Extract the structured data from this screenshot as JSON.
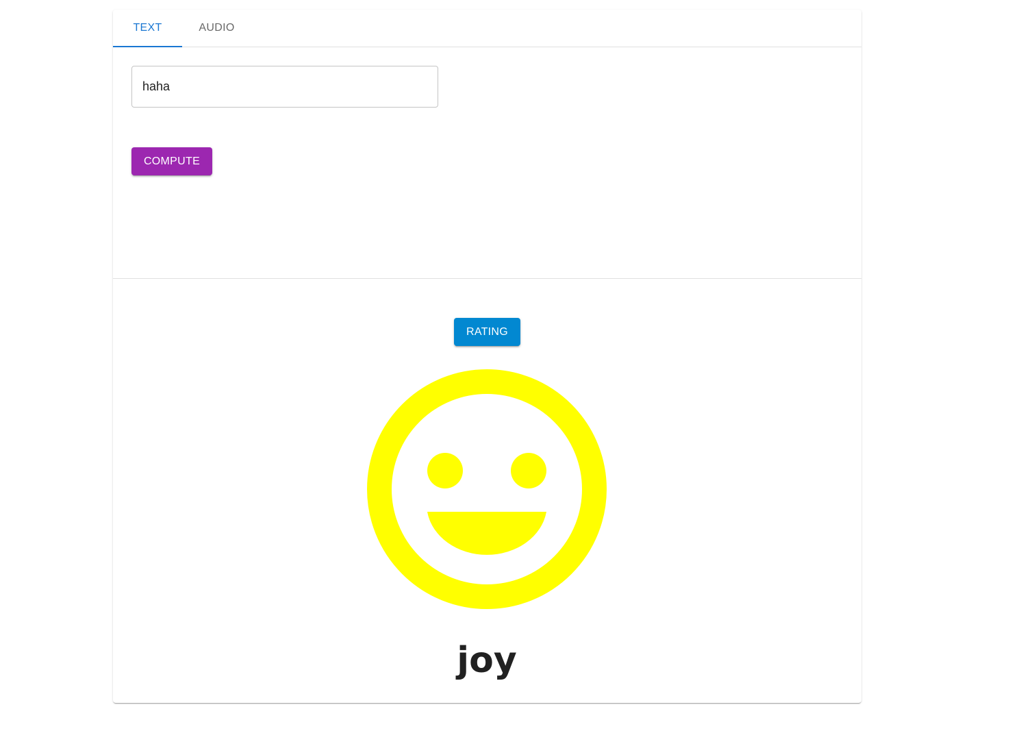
{
  "tabs": [
    {
      "label": "TEXT",
      "selected": true
    },
    {
      "label": "AUDIO",
      "selected": false
    }
  ],
  "input": {
    "value": "haha"
  },
  "buttons": {
    "compute_label": "COMPUTE",
    "rating_label": "RATING"
  },
  "result": {
    "icon": "smiley-face-icon",
    "emotion": "joy"
  },
  "colors": {
    "tab_active": "#1976d2",
    "compute_button": "#9c27b0",
    "rating_button": "#0288d1",
    "emoji": "#ffff00"
  }
}
